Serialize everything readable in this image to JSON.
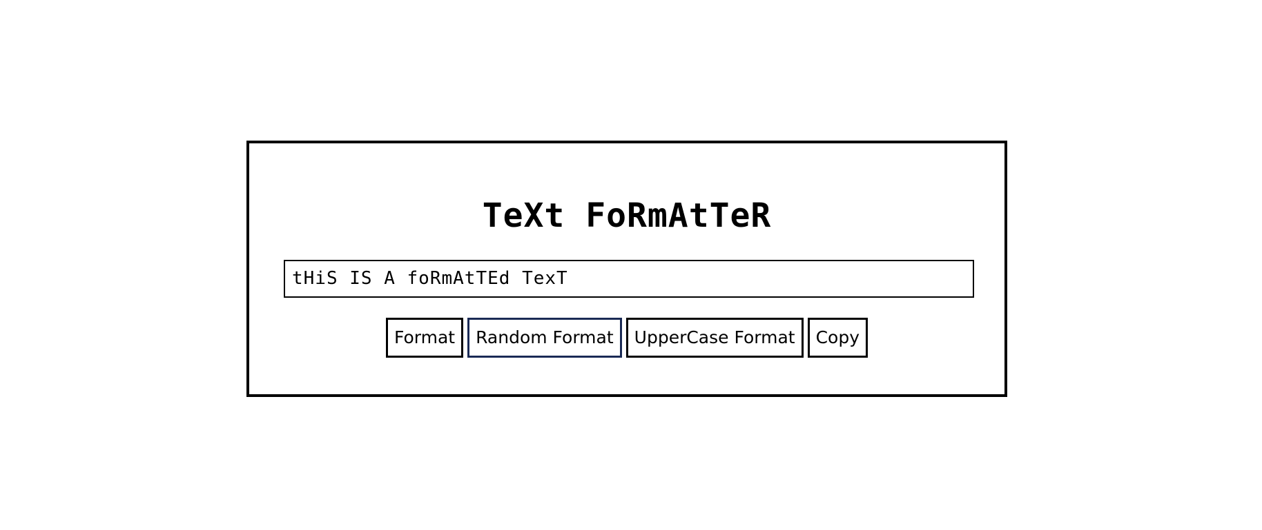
{
  "app": {
    "title": "TeXt FoRmAtTeR"
  },
  "input": {
    "value": "tHiS IS A foRmAtTEd TexT"
  },
  "buttons": {
    "format_label": "Format",
    "random_format_label": "Random Format",
    "uppercase_format_label": "UpperCase Format",
    "copy_label": "Copy"
  },
  "colors": {
    "background": "#ffffff",
    "border": "#000000",
    "focus_border": "#1a2a55",
    "text": "#000000"
  }
}
